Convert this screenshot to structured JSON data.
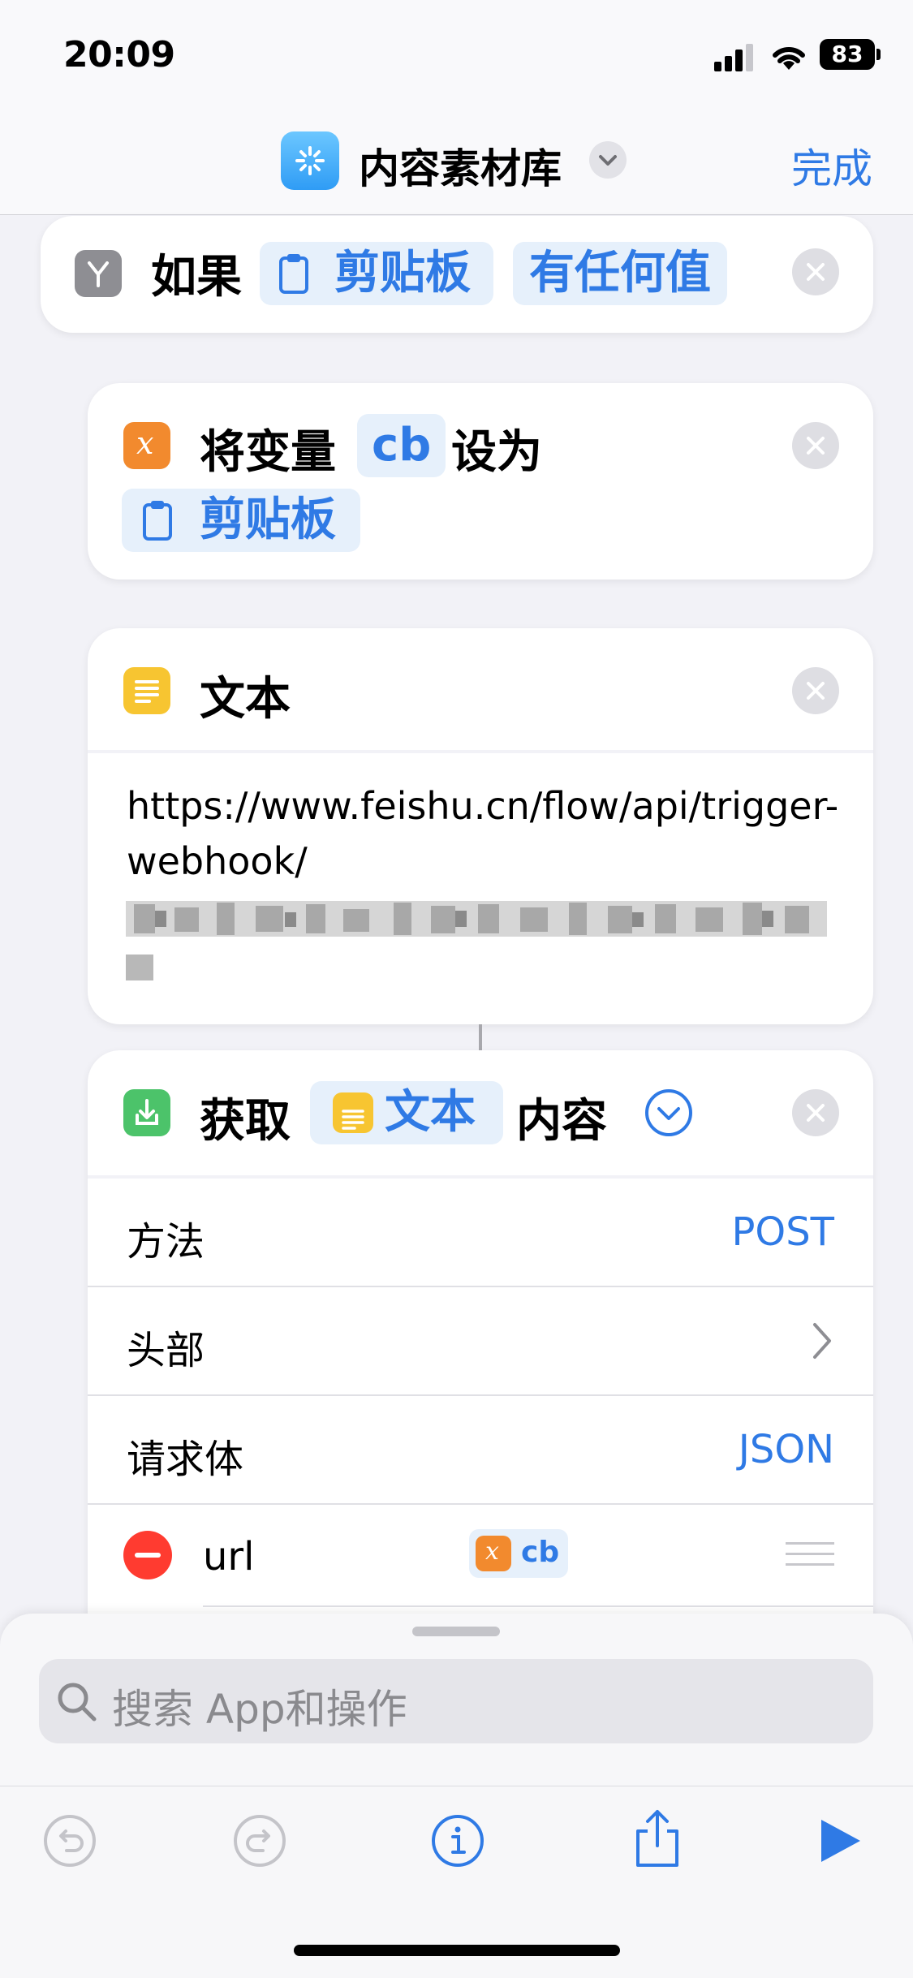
{
  "status": {
    "time": "20:09",
    "battery": "83"
  },
  "nav": {
    "title": "内容素材库",
    "done_label": "完成"
  },
  "if_block": {
    "keyword": "如果",
    "variable_token": "剪贴板",
    "condition_token": "有任何值"
  },
  "set_var_block": {
    "prefix": "将变量",
    "var_name": "cb",
    "suffix": "设为",
    "value_token": "剪贴板"
  },
  "text_block": {
    "title": "文本",
    "content_line1": "https://www.feishu.cn/flow/api/trigger-",
    "content_line2": "webhook/"
  },
  "get_block": {
    "prefix": "获取",
    "source_token": "文本",
    "suffix": "内容",
    "rows": {
      "method_label": "方法",
      "method_value": "POST",
      "headers_label": "头部",
      "body_label": "请求体",
      "body_value": "JSON"
    },
    "field": {
      "key": "url",
      "value_token": "cb"
    }
  },
  "search": {
    "placeholder": "搜索 App和操作"
  },
  "icons": {
    "if": "branch-icon",
    "variable": "variable-x-icon",
    "text": "text-doc-icon",
    "get": "download-icon",
    "clipboard": "clipboard-icon",
    "close": "close-icon",
    "undo": "undo-icon",
    "redo": "redo-icon",
    "info": "info-icon",
    "share": "share-icon",
    "play": "play-icon",
    "search": "search-icon"
  },
  "colors": {
    "accent": "#2f7ae5",
    "orange": "#f28a2e",
    "yellow": "#f7c531",
    "green": "#4cc36a",
    "remove": "#ff3b30"
  }
}
